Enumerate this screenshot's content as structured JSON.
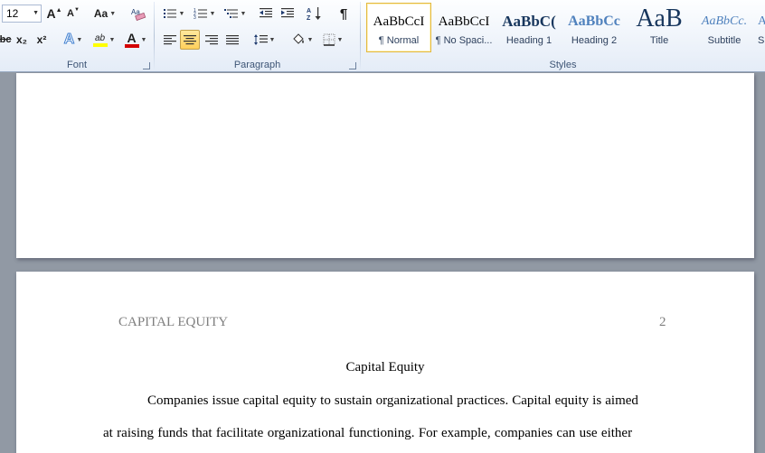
{
  "ribbon": {
    "font_group": {
      "label": "Font",
      "font_size": "12",
      "grow_font": "A",
      "shrink_font": "A",
      "change_case": "Aa",
      "clear_formatting_icon": "clear-formatting-icon",
      "strikethrough": "abc",
      "subscript": "x₂",
      "superscript": "x²",
      "text_effects": "A",
      "highlight": "ab",
      "font_color": "A",
      "font_color_value": "#d40000",
      "highlight_color_value": "#ffff00"
    },
    "paragraph_group": {
      "label": "Paragraph",
      "show_marks": "¶"
    },
    "styles_group": {
      "label": "Styles",
      "items": [
        {
          "sample": "AaBbCcI",
          "name": "¶ Normal",
          "selected": true
        },
        {
          "sample": "AaBbCcI",
          "name": "¶ No Spaci..."
        },
        {
          "sample": "AaBbC(",
          "name": "Heading 1"
        },
        {
          "sample": "AaBbCc",
          "name": "Heading 2"
        },
        {
          "sample": "AaB",
          "name": "Title"
        },
        {
          "sample": "AaBbCc.",
          "name": "Subtitle"
        },
        {
          "sample": "A",
          "name": "S"
        }
      ]
    }
  },
  "document": {
    "running_head": "CAPITAL EQUITY",
    "page_number": "2",
    "title": "Capital Equity",
    "lines": [
      "Companies issue capital equity to sustain organizational practices. Capital equity is aimed",
      "at raising funds that facilitate organizational functioning. For example, companies can use either"
    ]
  }
}
